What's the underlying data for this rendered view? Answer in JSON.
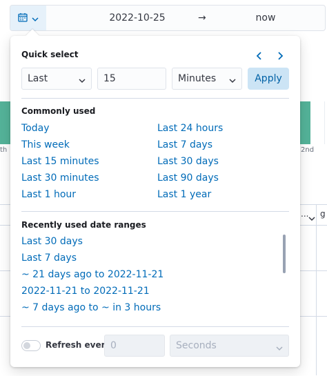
{
  "datepicker": {
    "start": "2022-10-25",
    "arrow": "→",
    "end": "now"
  },
  "background": {
    "bar_labels": [
      "th",
      "2nd"
    ],
    "column_headers": [
      "...",
      "g"
    ]
  },
  "quick_select": {
    "title": "Quick select",
    "direction": "Last",
    "amount": "15",
    "unit": "Minutes",
    "apply_label": "Apply"
  },
  "commonly_used": {
    "title": "Commonly used",
    "left": [
      "Today",
      "This week",
      "Last 15 minutes",
      "Last 30 minutes",
      "Last 1 hour"
    ],
    "right": [
      "Last 24 hours",
      "Last 7 days",
      "Last 30 days",
      "Last 90 days",
      "Last 1 year"
    ]
  },
  "recently_used": {
    "title": "Recently used date ranges",
    "items": [
      "Last 30 days",
      "Last 7 days",
      "~ 21 days ago to 2022-11-21",
      "2022-11-21 to 2022-11-21",
      "~ 7 days ago to ~ in 3 hours"
    ]
  },
  "refresh": {
    "label": "Refresh every",
    "interval_placeholder": "0",
    "unit": "Seconds"
  },
  "colors": {
    "accent": "#006bb8",
    "apply_bg": "#cce4f5",
    "bar": "#54b399"
  }
}
